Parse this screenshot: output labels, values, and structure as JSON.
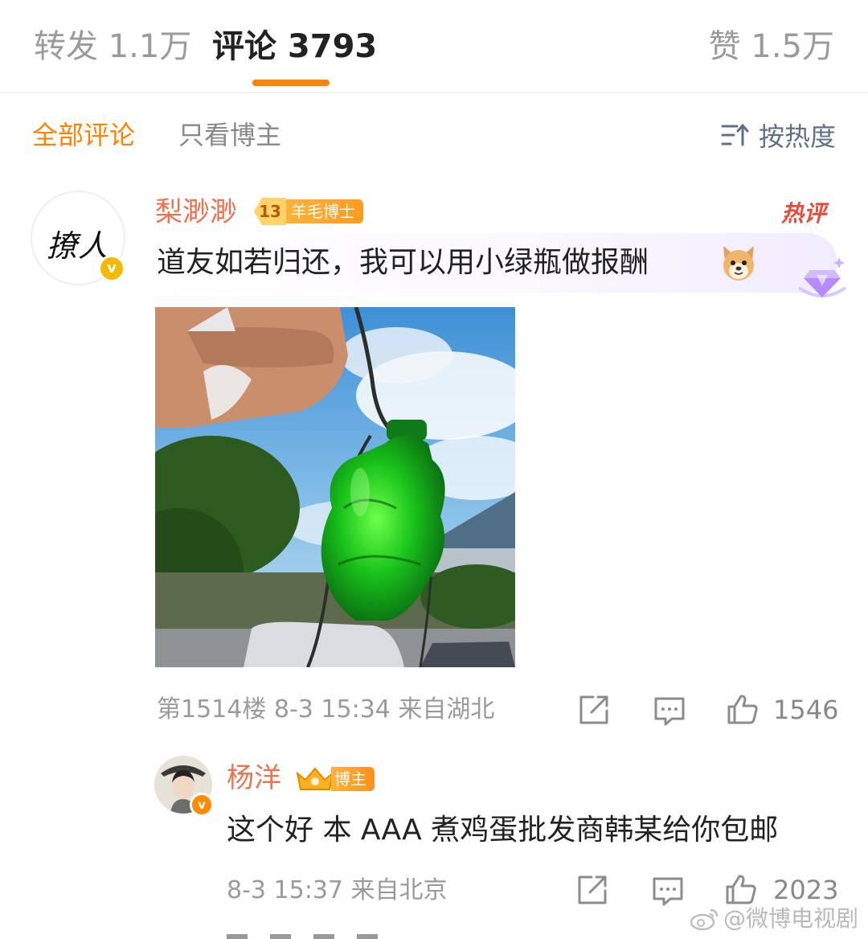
{
  "tabs": {
    "repost": "转发 1.1万",
    "comments": "评论 3793",
    "likes": "赞 1.5万"
  },
  "filters": {
    "all": "全部评论",
    "host_only": "只看博主",
    "sort": "按热度"
  },
  "comment": {
    "avatar_text": "撩人",
    "avatar_badge": "v",
    "username": "梨渺渺",
    "level": "13",
    "level_title": "羊毛博士",
    "hot_label": "热评",
    "text": "道友如若归还，我可以用小绿瓶做报酬",
    "meta": "第1514楼 8-3 15:34 来自湖北",
    "like_count": "1546"
  },
  "reply": {
    "avatar_badge": "v",
    "username": "杨洋",
    "badge": "博主",
    "text": "这个好 本 AAA 煮鸡蛋批发商韩某给你包邮",
    "meta": "8-3 15:37 来自北京",
    "like_count": "2023"
  },
  "watermark": "@微博电视剧",
  "colors": {
    "accent": "#ff8200",
    "username": "#eb7350",
    "hot": "#e84a3c",
    "muted": "#9a9a9a",
    "sort": "#5f6f87"
  }
}
